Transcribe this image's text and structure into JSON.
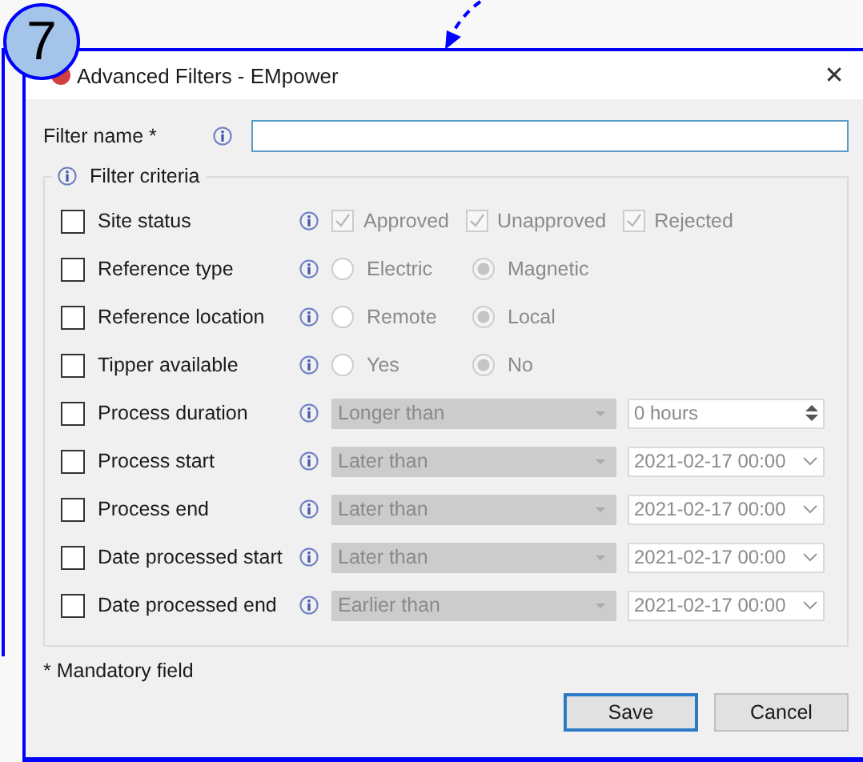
{
  "annotation": {
    "step": "7"
  },
  "window": {
    "title": "Advanced Filters - EMpower",
    "close": "✕"
  },
  "filter_name": {
    "label": "Filter name *"
  },
  "criteria": {
    "title": "Filter criteria",
    "rows": [
      {
        "label": "Site status",
        "checked": false,
        "kind": "checks",
        "options": [
          {
            "label": "Approved",
            "checked": true
          },
          {
            "label": "Unapproved",
            "checked": true
          },
          {
            "label": "Rejected",
            "checked": true
          }
        ]
      },
      {
        "label": "Reference type",
        "checked": false,
        "kind": "radio",
        "options": [
          {
            "label": "Electric",
            "selected": false
          },
          {
            "label": "Magnetic",
            "selected": true
          }
        ]
      },
      {
        "label": "Reference location",
        "checked": false,
        "kind": "radio",
        "options": [
          {
            "label": "Remote",
            "selected": false
          },
          {
            "label": "Local",
            "selected": true
          }
        ]
      },
      {
        "label": "Tipper available",
        "checked": false,
        "kind": "radio",
        "options": [
          {
            "label": "Yes",
            "selected": false
          },
          {
            "label": "No",
            "selected": true
          }
        ]
      },
      {
        "label": "Process duration",
        "checked": false,
        "kind": "spin",
        "condition": "Longer than",
        "value": "0 hours"
      },
      {
        "label": "Process start",
        "checked": false,
        "kind": "date",
        "condition": "Later than",
        "value": "2021-02-17 00:00"
      },
      {
        "label": "Process end",
        "checked": false,
        "kind": "date",
        "condition": "Later than",
        "value": "2021-02-17 00:00"
      },
      {
        "label": "Date processed start",
        "checked": false,
        "kind": "date",
        "condition": "Later than",
        "value": "2021-02-17 00:00"
      },
      {
        "label": "Date processed end",
        "checked": false,
        "kind": "date",
        "condition": "Earlier than",
        "value": "2021-02-17 00:00"
      }
    ]
  },
  "footnote": "* Mandatory field",
  "buttons": [
    {
      "label": "Save",
      "default": true
    },
    {
      "label": "Cancel",
      "default": false
    }
  ]
}
